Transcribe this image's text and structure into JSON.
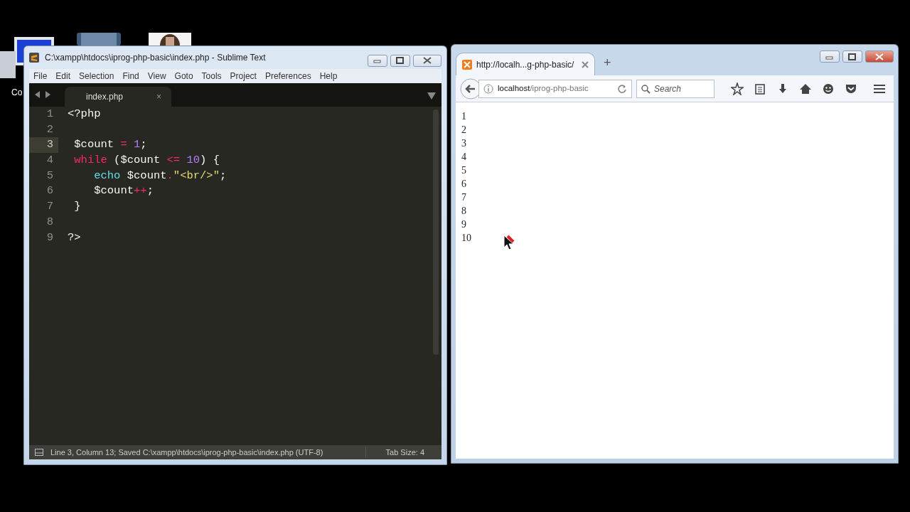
{
  "desktop": {
    "icons": [
      {
        "label": "Co",
        "kind": "computer"
      },
      {
        "kind": "bin"
      },
      {
        "kind": "picture"
      }
    ]
  },
  "editor": {
    "title": "C:\\xampp\\htdocs\\iprog-php-basic\\index.php - Sublime Text",
    "menu": [
      "File",
      "Edit",
      "Selection",
      "Find",
      "View",
      "Goto",
      "Tools",
      "Project",
      "Preferences",
      "Help"
    ],
    "tabs": [
      {
        "label": "index.php",
        "close": "×",
        "selected": true
      }
    ],
    "lines": [
      {
        "number": "1",
        "current": false,
        "tokens": [
          {
            "text": "<?php",
            "kind": "plain"
          }
        ]
      },
      {
        "number": "2",
        "current": false
      },
      {
        "number": "3",
        "current": true,
        "tokens": [
          {
            "text": " $count ",
            "kind": "plain"
          },
          {
            "text": "= ",
            "kind": "operator"
          },
          {
            "text": "1",
            "kind": "number"
          },
          {
            "text": ";",
            "kind": "plain"
          }
        ]
      },
      {
        "number": "4",
        "current": false,
        "tokens": [
          {
            "text": " while",
            "kind": "keyword"
          },
          {
            "text": " ($count ",
            "kind": "plain"
          },
          {
            "text": "<= ",
            "kind": "operator"
          },
          {
            "text": "10",
            "kind": "number"
          },
          {
            "text": ") {",
            "kind": "plain"
          }
        ]
      },
      {
        "number": "5",
        "current": false,
        "tokens": [
          {
            "text": "    echo",
            "kind": "function"
          },
          {
            "text": " $count",
            "kind": "plain"
          },
          {
            "text": ".",
            "kind": "operator"
          },
          {
            "text": "\"<br/>\"",
            "kind": "string"
          },
          {
            "text": ";",
            "kind": "plain"
          }
        ]
      },
      {
        "number": "6",
        "current": false,
        "tokens": [
          {
            "text": "    $count",
            "kind": "plain"
          },
          {
            "text": "++",
            "kind": "operator"
          },
          {
            "text": ";",
            "kind": "plain"
          }
        ]
      },
      {
        "number": "7",
        "current": false,
        "tokens": [
          {
            "text": " }",
            "kind": "plain"
          }
        ]
      },
      {
        "number": "8",
        "current": false
      },
      {
        "number": "9",
        "current": false,
        "tokens": [
          {
            "text": "?>",
            "kind": "plain"
          }
        ]
      }
    ],
    "status_bar": {
      "message": "Line 3, Column 13; Saved C:\\xampp\\htdocs\\iprog-php-basic\\index.php (UTF-8)",
      "tab_size": "Tab Size: 4"
    }
  },
  "browser": {
    "tabs": [
      {
        "label": "http://localh...g-php-basic/",
        "selected": true
      }
    ],
    "new_tab": "+",
    "address": {
      "host": "localhost",
      "path": "/iprog-php-basic"
    },
    "search": {
      "placeholder": "Search"
    },
    "output": [
      "1",
      "2",
      "3",
      "4",
      "5",
      "6",
      "7",
      "8",
      "9",
      "10"
    ]
  }
}
